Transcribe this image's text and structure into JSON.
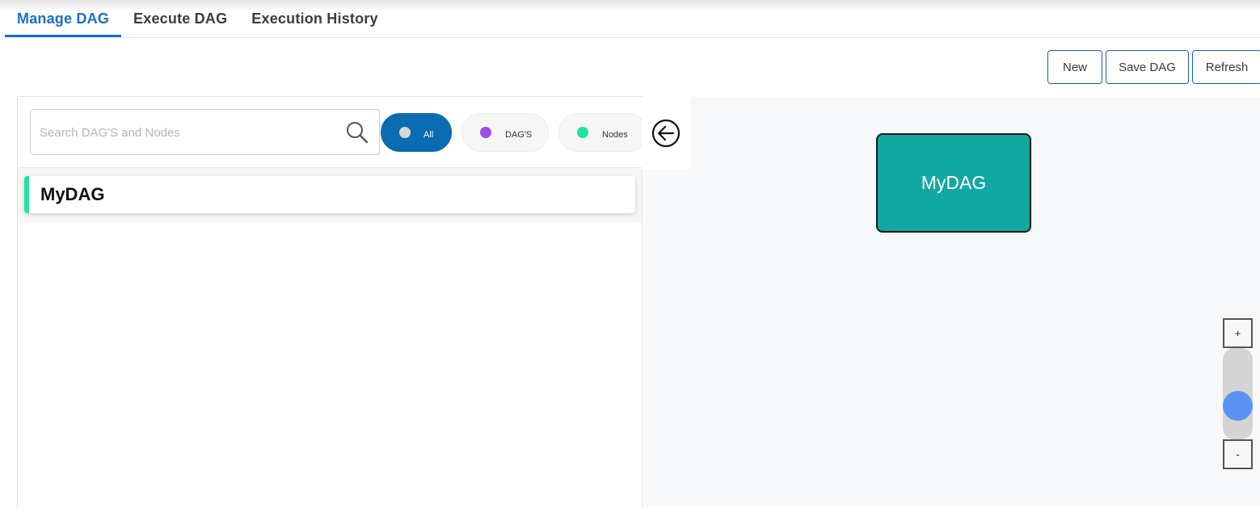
{
  "tabs": [
    {
      "label": "Manage DAG",
      "active": true
    },
    {
      "label": "Execute DAG",
      "active": false
    },
    {
      "label": "Execution History",
      "active": false
    }
  ],
  "toolbar": {
    "new_label": "New",
    "save_label": "Save DAG",
    "refresh_label": "Refresh"
  },
  "search": {
    "placeholder": "Search DAG'S and Nodes",
    "value": ""
  },
  "filters": {
    "all": {
      "label": "All",
      "selected": true
    },
    "dags": {
      "label": "DAG'S",
      "color": "#9b4fe6"
    },
    "nodes": {
      "label": "Nodes",
      "color": "#1ee3a3"
    }
  },
  "list": {
    "items": [
      {
        "name": "MyDAG",
        "type": "dag"
      }
    ]
  },
  "canvas": {
    "nodes": [
      {
        "label": "MyDAG",
        "color": "#12a8a2"
      }
    ]
  },
  "zoom": {
    "plus_label": "+",
    "minus_label": "-",
    "level_fraction": 0.3
  },
  "colors": {
    "accent": "#1a6fc4",
    "all_filter": "#0a6bb0",
    "slider_thumb": "#5b93f5"
  }
}
